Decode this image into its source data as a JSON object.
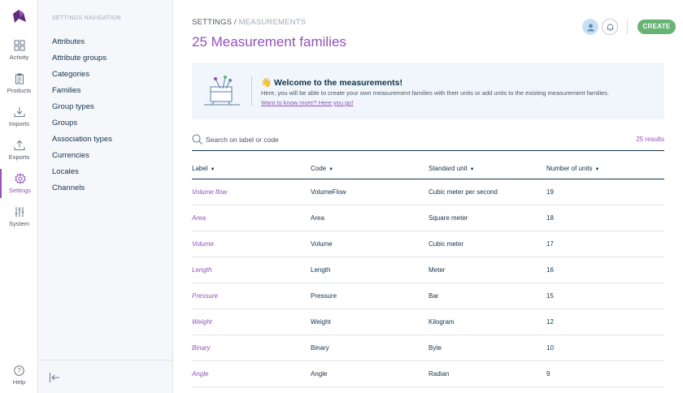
{
  "main_nav": {
    "items": [
      {
        "label": "Activity",
        "icon": "dashboard-icon"
      },
      {
        "label": "Products",
        "icon": "clipboard-icon"
      },
      {
        "label": "Imports",
        "icon": "import-icon"
      },
      {
        "label": "Exports",
        "icon": "export-icon"
      },
      {
        "label": "Settings",
        "icon": "gear-icon",
        "active": true
      },
      {
        "label": "System",
        "icon": "sliders-icon"
      }
    ],
    "help_label": "Help"
  },
  "settings_nav": {
    "title": "SETTINGS NAVIGATION",
    "items": [
      "Attributes",
      "Attribute groups",
      "Categories",
      "Families",
      "Group types",
      "Groups",
      "Association types",
      "Currencies",
      "Locales",
      "Channels"
    ]
  },
  "breadcrumb": {
    "root": "SETTINGS",
    "separator": "/",
    "current": "MEASUREMENTS"
  },
  "page_title": "25 Measurement families",
  "create_label": "CREATE",
  "welcome": {
    "emoji": "👋",
    "title": "Welcome to the measurements!",
    "description": "Here, you will be able to create your own measurement families with their units or add units to the existing measurement families.",
    "link": "Want to know more? Here you go!"
  },
  "search": {
    "placeholder": "Search on label or code",
    "result_count": "25 results"
  },
  "table": {
    "headers": [
      "Label",
      "Code",
      "Standard unit",
      "Number of units"
    ],
    "rows": [
      {
        "label": "Volume flow",
        "code": "VolumeFlow",
        "unit": "Cubic meter per second",
        "count": "19"
      },
      {
        "label": "Area",
        "code": "Area",
        "unit": "Square meter",
        "count": "18"
      },
      {
        "label": "Volume",
        "code": "Volume",
        "unit": "Cubic meter",
        "count": "17"
      },
      {
        "label": "Length",
        "code": "Length",
        "unit": "Meter",
        "count": "16"
      },
      {
        "label": "Pressure",
        "code": "Pressure",
        "unit": "Bar",
        "count": "15"
      },
      {
        "label": "Weight",
        "code": "Weight",
        "unit": "Kilogram",
        "count": "12"
      },
      {
        "label": "Binary",
        "code": "Binary",
        "unit": "Byte",
        "count": "10"
      },
      {
        "label": "Angle",
        "code": "Angle",
        "unit": "Radian",
        "count": "9"
      }
    ]
  },
  "colors": {
    "accent": "#9452ba",
    "primary_text": "#11324d",
    "create_button": "#67b373",
    "welcome_bg": "#f0f6fb"
  }
}
